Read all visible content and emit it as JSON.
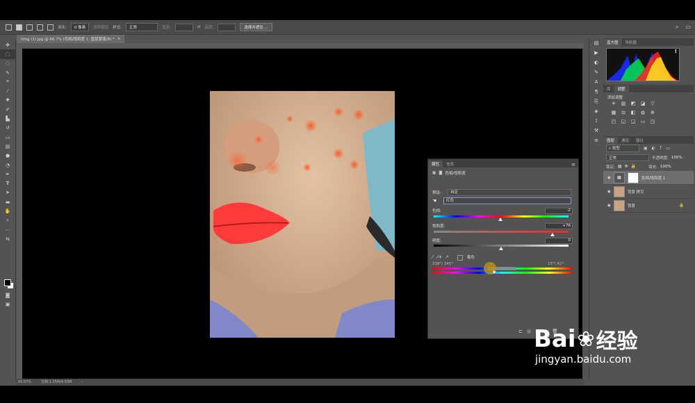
{
  "options_bar": {
    "feather_label": "羽化:",
    "feather_value": "0 像素",
    "antialias_label": "消除锯齿",
    "style_label": "样式:",
    "style_value": "正常",
    "width_label": "宽度:",
    "height_label": "高度:",
    "select_mask_button": "选择并遮住 ..."
  },
  "document_tab": {
    "title": "timg (1).jpg @ 66.7% (色相/饱和度 1, 图层蒙版/8) *",
    "close": "×"
  },
  "status_bar": {
    "zoom": "66.67%",
    "doc_size": "文档:1.25M/4.50M"
  },
  "histogram_panel": {
    "tabs": [
      "直方图",
      "导航器"
    ],
    "warning": "!"
  },
  "adjustments_panel": {
    "tabs": [
      "库",
      "调整"
    ],
    "heading": "添加调整"
  },
  "layers_panel": {
    "tabs": [
      "图层",
      "通道",
      "路径"
    ],
    "kind_filter": "类型",
    "blend_mode": "正常",
    "opacity_label": "不透明度:",
    "opacity_value": "100%",
    "lock_label": "锁定:",
    "fill_label": "填充:",
    "fill_value": "100%",
    "layers": [
      {
        "name": "色相/饱和度 1",
        "selected": true
      },
      {
        "name": "背景 拷贝",
        "selected": false
      },
      {
        "name": "背景",
        "selected": false
      }
    ]
  },
  "properties_panel": {
    "tabs": [
      "属性",
      "信息"
    ],
    "title": "色相/饱和度",
    "preset_label": "预设:",
    "preset_value": "自定",
    "channel_value": "红色",
    "hue_label": "色相:",
    "hue_value": "-2",
    "hue_level": 0.494,
    "saturation_label": "饱和度:",
    "saturation_value": "+76",
    "saturation_level": 0.88,
    "lightness_label": "明度:",
    "lightness_value": "0",
    "lightness_level": 0.5,
    "colorize_label": "着色",
    "range_left": "338°/ 345°",
    "range_right": "15°\\ 42°"
  },
  "watermark": {
    "brand": "Bai",
    "brand_cn": "经验",
    "url": "jingyan.baidu.com"
  },
  "colors": {
    "panel": "#535353",
    "canvas": "#000000",
    "accent_select": "#6e6e6e"
  }
}
